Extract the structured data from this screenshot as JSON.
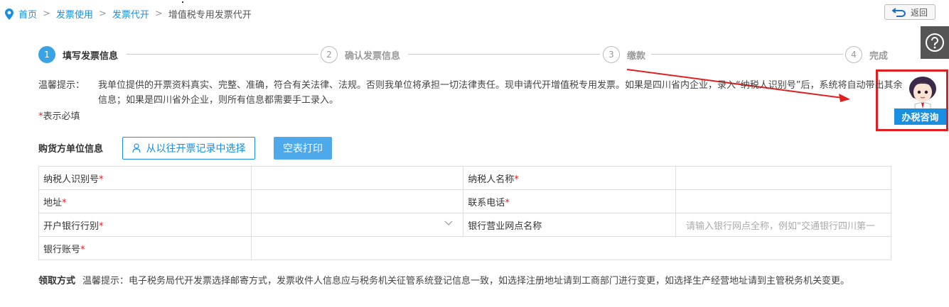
{
  "breadcrumb": {
    "home": "首页",
    "level1": "发票使用",
    "level2": "发票代开",
    "current": "增值税专用发票代开",
    "separator": ">"
  },
  "back_button": {
    "label": "返回",
    "icon": "return-arrow-icon"
  },
  "help": {
    "icon": "question-circle-icon"
  },
  "consult": {
    "label": "办税咨询",
    "avatar": "customer-service-avatar"
  },
  "steps": [
    {
      "num": "1",
      "label": "填写发票信息",
      "active": true
    },
    {
      "num": "2",
      "label": "确认发票信息",
      "active": false
    },
    {
      "num": "3",
      "label": "缴款",
      "active": false
    },
    {
      "num": "4",
      "label": "完成",
      "active": false
    }
  ],
  "tip": {
    "label": "温馨提示：",
    "text": "我单位提供的开票资料真实、完整、准确，符合有关法律、法规。否则我单位将承担一切法律责任。现申请代开增值税专用发票。如果是四川省内企业，录入“纳税人识别号”后，系统将自动带出其余信息；如果是四川省外企业，则所有信息都需要手工录入。"
  },
  "required_note": {
    "star": "*",
    "text": "表示必填"
  },
  "buyer": {
    "title": "购货方单位信息",
    "history_button": "从以往开票记录中选择",
    "print_button": "空表打印"
  },
  "form": {
    "taxpayer_id_label": "纳税人识别号",
    "taxpayer_name_label": "纳税人名称",
    "address_label": "地址",
    "phone_label": "联系电话",
    "bank_label": "开户银行行别",
    "branch_label": "银行营业网点名称",
    "branch_placeholder": "请输入银行网点全称，例如\"交通银行四川第一",
    "account_label": "银行账号",
    "star": "*"
  },
  "pickup": {
    "title": "领取方式",
    "text": "温馨提示：电子税务局代开发票选择邮寄方式，发票收件人信息应与税务机关征管系统登记信息一致，如选择注册地址请到工商部门进行变更，如选择生产经营地址请到主管税务机关变更。"
  },
  "colors": {
    "accent": "#1a8fe0",
    "active_step": "#3aa3e3",
    "annotation": "#e02020"
  }
}
